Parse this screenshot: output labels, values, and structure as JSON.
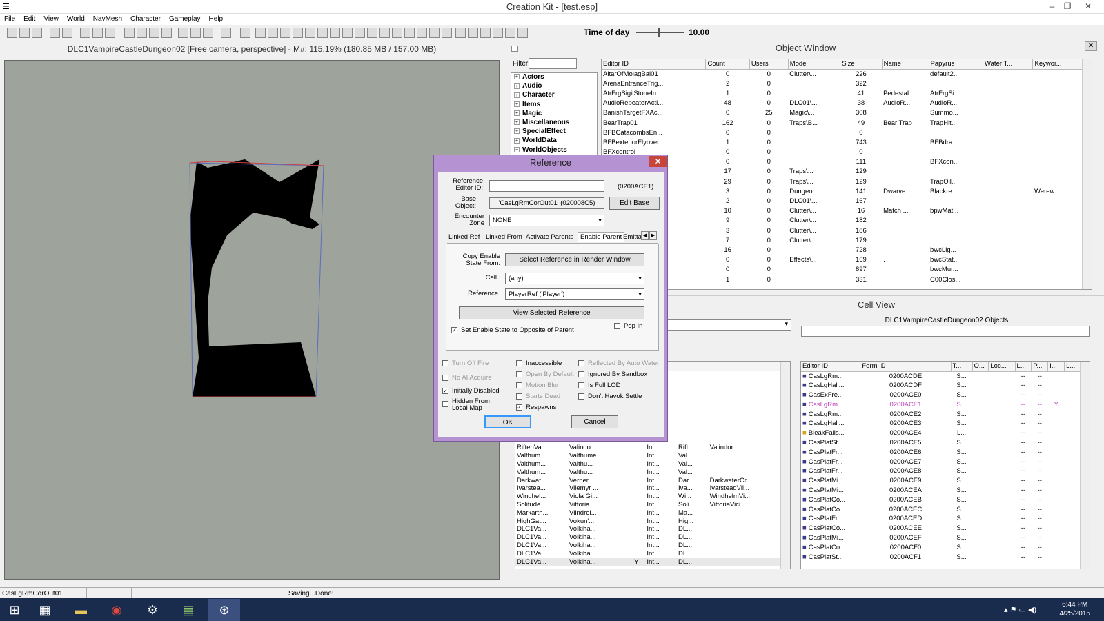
{
  "window": {
    "title": "Creation Kit - [test.esp]"
  },
  "menu": [
    "File",
    "Edit",
    "View",
    "World",
    "NavMesh",
    "Character",
    "Gameplay",
    "Help"
  ],
  "toolbar": {
    "time_of_day_label": "Time of day",
    "time_of_day_value": "10.00"
  },
  "render": {
    "title": "DLC1VampireCastleDungeon02 [Free camera, perspective] - M#: 115.19% (180.85 MB / 157.00 MB)"
  },
  "object_window": {
    "title": "Object Window",
    "filter_label": "Filter",
    "tree": [
      "Actors",
      "Audio",
      "Character",
      "Items",
      "Magic",
      "Miscellaneous",
      "SpecialEffect",
      "WorldData",
      "WorldObjects"
    ],
    "columns": [
      "Editor ID",
      "Count",
      "Users",
      "Model",
      "Size",
      "Name",
      "Papyrus",
      "Water T...",
      "Keywor..."
    ],
    "rows": [
      [
        "AltarOfMolagBal01",
        "0",
        "0",
        "Clutter\\...",
        "226",
        "",
        "default2...",
        "",
        ""
      ],
      [
        "ArenaEntranceTrig...",
        "2",
        "0",
        "",
        "322",
        "",
        "",
        "",
        ""
      ],
      [
        "AtrFrgSigilStoneIn...",
        "1",
        "0",
        "",
        "41",
        "Pedestal",
        "AtrFrgSi...",
        "",
        ""
      ],
      [
        "AudioRepeaterActi...",
        "48",
        "0",
        "DLC01\\...",
        "38",
        "AudioR...",
        "AudioR...",
        "",
        ""
      ],
      [
        "BanishTargetFXAc...",
        "0",
        "25",
        "Magic\\...",
        "308",
        "",
        "Summo...",
        "",
        ""
      ],
      [
        "BearTrap01",
        "162",
        "0",
        "Traps\\B...",
        "49",
        "Bear Trap",
        "TrapHit...",
        "",
        ""
      ],
      [
        "BFBCatacombsEn...",
        "0",
        "0",
        "",
        "0",
        "",
        "",
        "",
        ""
      ],
      [
        "BFBexteriorFlyover...",
        "1",
        "0",
        "",
        "743",
        "",
        "BFBdra...",
        "",
        ""
      ],
      [
        "BFXcontrol",
        "0",
        "0",
        "",
        "0",
        "",
        "",
        "",
        ""
      ],
      [
        "",
        "0",
        "0",
        "",
        "111",
        "",
        "BFXcon...",
        "",
        ""
      ],
      [
        "",
        "17",
        "0",
        "Traps\\...",
        "129",
        "",
        "",
        "",
        ""
      ],
      [
        "",
        "29",
        "0",
        "Traps\\...",
        "129",
        "",
        "TrapOil...",
        "",
        ""
      ],
      [
        "",
        "3",
        "0",
        "Dungeo...",
        "141",
        "Dwarve...",
        "Blackre...",
        "",
        "Werew..."
      ],
      [
        "",
        "2",
        "0",
        "DLC01\\...",
        "167",
        "",
        "",
        "",
        ""
      ],
      [
        "",
        "10",
        "0",
        "Clutter\\...",
        "16",
        "Match ...",
        "bpwMat...",
        "",
        ""
      ],
      [
        "",
        "9",
        "0",
        "Clutter\\...",
        "182",
        "",
        "",
        "",
        ""
      ],
      [
        "",
        "3",
        "0",
        "Clutter\\...",
        "186",
        "",
        "",
        "",
        ""
      ],
      [
        "",
        "7",
        "0",
        "Clutter\\...",
        "179",
        "",
        "",
        "",
        ""
      ],
      [
        "",
        "16",
        "0",
        "",
        "728",
        "",
        "bwcLig...",
        "",
        ""
      ],
      [
        "",
        "0",
        "0",
        "Effects\\...",
        "169",
        ".",
        "bwcStat...",
        "",
        ""
      ],
      [
        "",
        "0",
        "0",
        "",
        "897",
        "",
        "bwcMur...",
        "",
        ""
      ],
      [
        "",
        "1",
        "0",
        "",
        "331",
        "",
        "C00Clos...",
        "",
        ""
      ]
    ]
  },
  "cell_view": {
    "title": "Cell View",
    "objects_label": "DLC1VampireCastleDungeon02 Objects",
    "left_rows": [
      [
        "RiftenVa...",
        "Valindo...",
        "",
        "Int...",
        "Rift...",
        "Valindor"
      ],
      [
        "Valthum...",
        "Valthume",
        "",
        "Int...",
        "Val...",
        ""
      ],
      [
        "Valthum...",
        "Valthu...",
        "",
        "Int...",
        "Val...",
        ""
      ],
      [
        "Valthum...",
        "Valthu...",
        "",
        "Int...",
        "Val...",
        ""
      ],
      [
        "Darkwat...",
        "Verner ...",
        "",
        "Int...",
        "Dar...",
        "DarkwaterCr..."
      ],
      [
        "Ivarstea...",
        "Vilemyr ...",
        "",
        "Int...",
        "Iva...",
        "IvarsteadVil..."
      ],
      [
        "Windhel...",
        "Viola Gi...",
        "",
        "Int...",
        "Wi...",
        "WindhelmVi..."
      ],
      [
        "Solitude...",
        "Vittoria ...",
        "",
        "Int...",
        "Soli...",
        "VittoriaVici"
      ],
      [
        "Markarth...",
        "Vlindrel...",
        "",
        "Int...",
        "Ma...",
        ""
      ],
      [
        "HighGat...",
        "Vokun'...",
        "",
        "Int...",
        "Hig...",
        ""
      ],
      [
        "DLC1Va...",
        "Volkiha...",
        "",
        "Int...",
        "DL...",
        ""
      ],
      [
        "DLC1Va...",
        "Volkiha...",
        "",
        "Int...",
        "DL...",
        ""
      ],
      [
        "DLC1Va...",
        "Volkiha...",
        "",
        "Int...",
        "DL...",
        ""
      ],
      [
        "DLC1Va...",
        "Volkiha...",
        "",
        "Int...",
        "DL...",
        ""
      ],
      [
        "DLC1Va...",
        "Volkiha...",
        "Y",
        "Int...",
        "DL...",
        ""
      ]
    ],
    "right_columns": [
      "Editor ID",
      "Form ID",
      "T...",
      "O...",
      "Loc...",
      "L...",
      "P...",
      "I...",
      "L..."
    ],
    "right_rows": [
      [
        "CasLgRm...",
        "0200ACDE",
        "S...",
        "",
        "",
        "--",
        "--",
        "",
        ""
      ],
      [
        "CasLgHall...",
        "0200ACDF",
        "S...",
        "",
        "",
        "--",
        "--",
        "",
        ""
      ],
      [
        "CasExFre...",
        "0200ACE0",
        "S...",
        "",
        "",
        "--",
        "--",
        "",
        ""
      ],
      [
        "CasLgRm...",
        "0200ACE1",
        "S...",
        "",
        "",
        "--",
        "--",
        "Y",
        ""
      ],
      [
        "CasLgRm...",
        "0200ACE2",
        "S...",
        "",
        "",
        "--",
        "--",
        "",
        ""
      ],
      [
        "CasLgHall...",
        "0200ACE3",
        "S...",
        "",
        "",
        "--",
        "--",
        "",
        ""
      ],
      [
        "BleakFalls...",
        "0200ACE4",
        "L...",
        "",
        "",
        "--",
        "--",
        "",
        ""
      ],
      [
        "CasPlatSt...",
        "0200ACE5",
        "S...",
        "",
        "",
        "--",
        "--",
        "",
        ""
      ],
      [
        "CasPlatFr...",
        "0200ACE6",
        "S...",
        "",
        "",
        "--",
        "--",
        "",
        ""
      ],
      [
        "CasPlatFr...",
        "0200ACE7",
        "S...",
        "",
        "",
        "--",
        "--",
        "",
        ""
      ],
      [
        "CasPlatFr...",
        "0200ACE8",
        "S...",
        "",
        "",
        "--",
        "--",
        "",
        ""
      ],
      [
        "CasPlatMi...",
        "0200ACE9",
        "S...",
        "",
        "",
        "--",
        "--",
        "",
        ""
      ],
      [
        "CasPlatMi...",
        "0200ACEA",
        "S...",
        "",
        "",
        "--",
        "--",
        "",
        ""
      ],
      [
        "CasPlatCo...",
        "0200ACEB",
        "S...",
        "",
        "",
        "--",
        "--",
        "",
        ""
      ],
      [
        "CasPlatCo...",
        "0200ACEC",
        "S...",
        "",
        "",
        "--",
        "--",
        "",
        ""
      ],
      [
        "CasPlatFr...",
        "0200ACED",
        "S...",
        "",
        "",
        "--",
        "--",
        "",
        ""
      ],
      [
        "CasPlatCo...",
        "0200ACEE",
        "S...",
        "",
        "",
        "--",
        "--",
        "",
        ""
      ],
      [
        "CasPlatMi...",
        "0200ACEF",
        "S...",
        "",
        "",
        "--",
        "--",
        "",
        ""
      ],
      [
        "CasPlatCo...",
        "0200ACF0",
        "S...",
        "",
        "",
        "--",
        "--",
        "",
        ""
      ],
      [
        "CasPlatSt...",
        "0200ACF1",
        "S...",
        "",
        "",
        "--",
        "--",
        "",
        ""
      ]
    ]
  },
  "dialog": {
    "title": "Reference",
    "close": "✕",
    "ref_editor_id_label": "Reference Editor ID:",
    "ref_editor_id_value": "",
    "form_id": "(0200ACE1)",
    "base_object_label": "Base Object:",
    "base_object_value": "'CasLgRmCorOut01' (020008C5)",
    "edit_base": "Edit Base",
    "encounter_zone_label": "Encounter Zone",
    "encounter_zone_value": "NONE",
    "tabs": [
      "Linked Ref",
      "Linked From",
      "Activate Parents",
      "Enable Parent",
      "Emitta"
    ],
    "copy_enable_label": "Copy Enable State From:",
    "select_ref_btn": "Select Reference in Render Window",
    "cell_label": "Cell",
    "cell_value": "(any)",
    "reference_label": "Reference",
    "reference_value": "PlayerRef ('Player')",
    "view_selected_btn": "View Selected Reference",
    "set_enable_opposite": "Set Enable State to Opposite of Parent",
    "pop_in": "Pop In",
    "turn_off_fire": "Turn Off Fire",
    "no_ai_acquire": "No AI Acquire",
    "initially_disabled": "Initially Disabled",
    "hidden_from_local_map": "Hidden From Local Map",
    "inaccessible": "Inaccessible",
    "open_by_default": "Open By Default",
    "motion_blur": "Motion Blur",
    "starts_dead": "Starts Dead",
    "respawns": "Respawns",
    "reflected_by_auto_water": "Reflected By Auto Water",
    "ignored_by_sandbox": "Ignored By Sandbox",
    "is_full_lod": "Is Full LOD",
    "dont_havok_settle": "Don't Havok Settle",
    "ok": "OK",
    "cancel": "Cancel"
  },
  "status": {
    "selected": "CasLgRmCorOut01",
    "message": "Saving...Done!"
  },
  "taskbar": {
    "time": "6:44 PM",
    "date": "4/25/2015"
  },
  "colors": {
    "dialog_frame": "#b592d1",
    "viewport_bg": "#9ea39b",
    "taskbar": "#1a2c4e",
    "selected_row": "#c040c0"
  }
}
